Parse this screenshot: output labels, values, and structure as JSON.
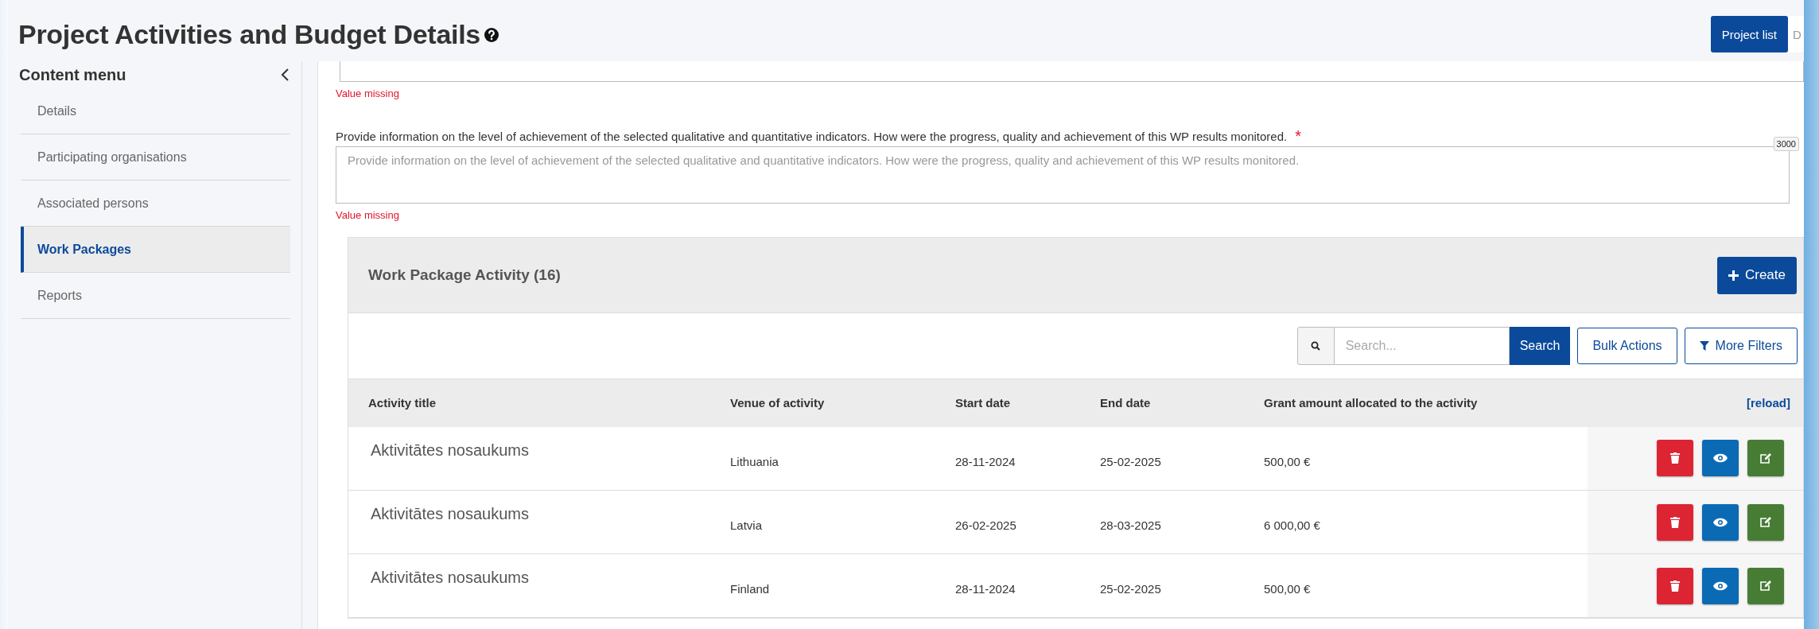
{
  "header": {
    "title": "Project Activities and Budget Details",
    "buttons": [
      {
        "label": "Project list",
        "selected": true
      },
      {
        "label": "D",
        "selected": false
      }
    ]
  },
  "sidebar": {
    "title": "Content menu",
    "items": [
      {
        "label": "Details",
        "selected": false
      },
      {
        "label": "Participating organisations",
        "selected": false
      },
      {
        "label": "Associated persons",
        "selected": false
      },
      {
        "label": "Work Packages",
        "selected": true
      },
      {
        "label": "Reports",
        "selected": false
      }
    ]
  },
  "form": {
    "fields": [
      {
        "error": "Value missing"
      },
      {
        "label": "Provide information on the level of achievement of the selected qualitative and quantitative indicators. How were the progress, quality and achievement of this WP results monitored.",
        "required_marker": "*",
        "placeholder": "Provide information on the level of achievement of the selected qualitative and quantitative indicators. How were the progress, quality and achievement of this WP results monitored.",
        "max_length": "3000",
        "error": "Value missing"
      }
    ]
  },
  "panel": {
    "title": "Work Package Activity (16)",
    "create_button": "Create",
    "search": {
      "placeholder": "Search...",
      "button": "Search"
    },
    "bulk_actions": "Bulk Actions",
    "more_filters": "More Filters",
    "table": {
      "columns": [
        "Activity title",
        "Venue of activity",
        "Start date",
        "End date",
        "Grant amount allocated to the activity"
      ],
      "reload": "[reload]",
      "rows": [
        {
          "cells": [
            "Aktivitātes nosaukums",
            "Lithuania",
            "28-11-2024",
            "25-02-2025",
            "500,00 €"
          ]
        },
        {
          "cells": [
            "Aktivitātes nosaukums",
            "Latvia",
            "26-02-2025",
            "28-03-2025",
            "6 000,00 €"
          ]
        },
        {
          "cells": [
            "Aktivitātes nosaukums",
            "Finland",
            "28-11-2024",
            "25-02-2025",
            "500,00 €"
          ]
        }
      ]
    }
  }
}
